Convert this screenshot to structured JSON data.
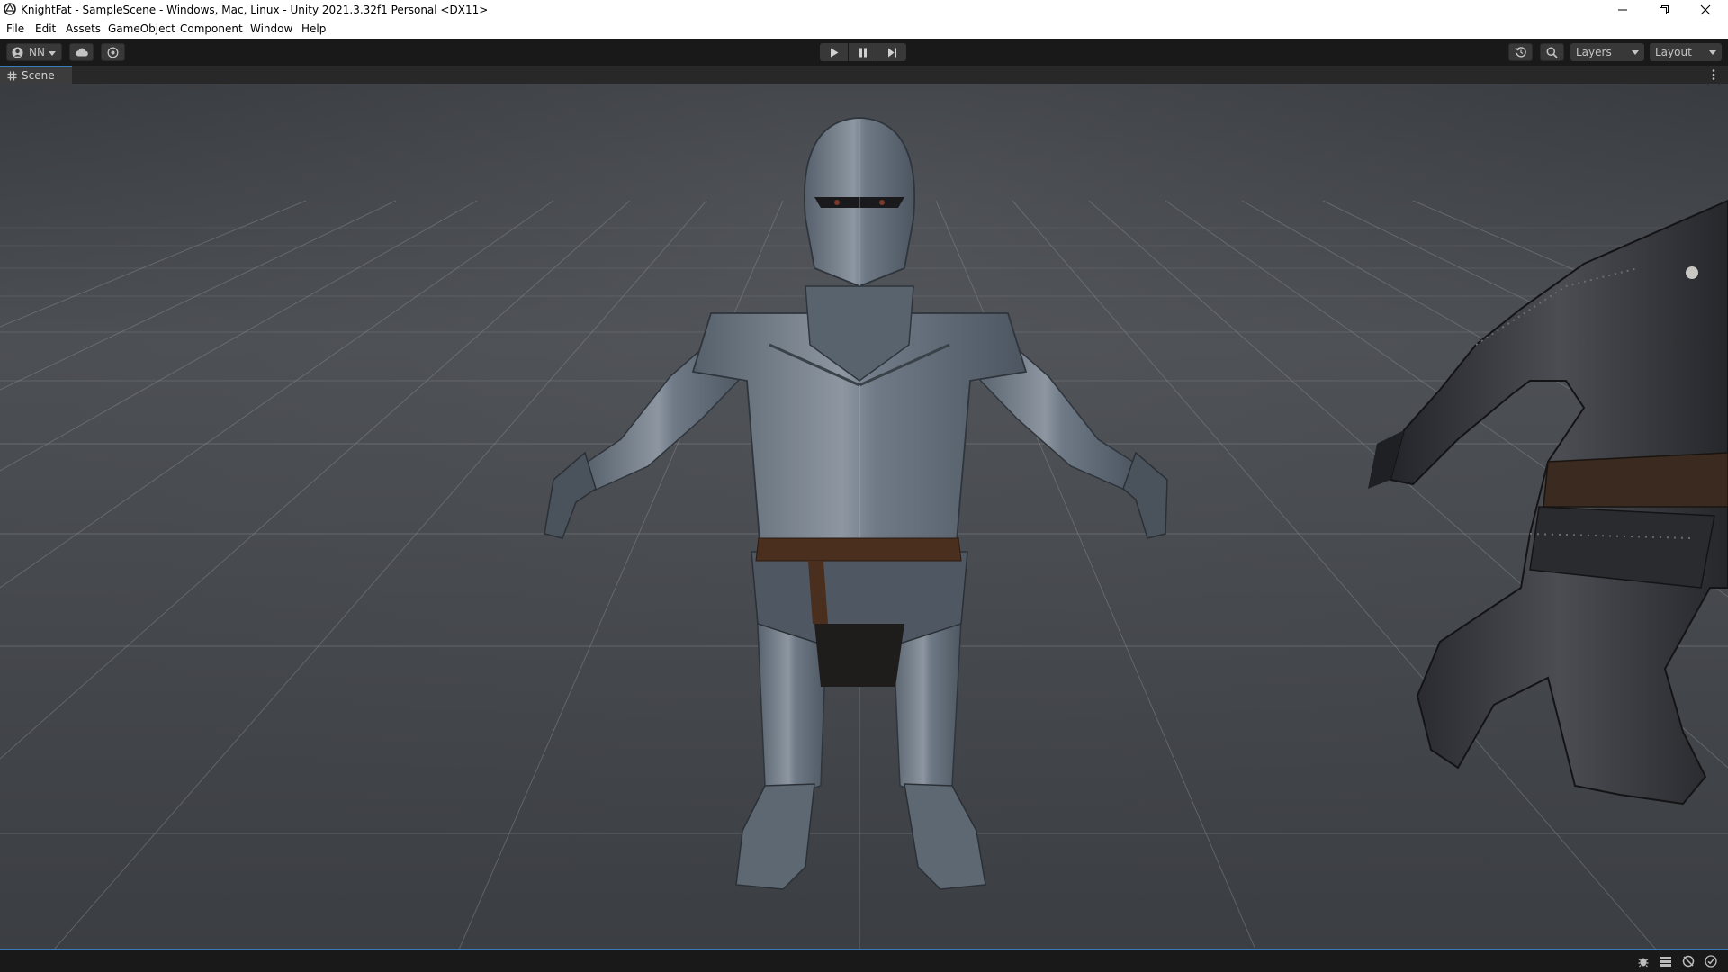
{
  "window": {
    "title": "KnightFat - SampleScene - Windows, Mac, Linux - Unity 2021.3.32f1 Personal <DX11>",
    "icon": "unity-icon",
    "controls": [
      "minimize-icon",
      "restore-icon",
      "close-icon"
    ]
  },
  "menubar": {
    "items": [
      "File",
      "Edit",
      "Assets",
      "GameObject",
      "Component",
      "Window",
      "Help"
    ]
  },
  "toolbar": {
    "account_label": "NN",
    "account_icon": "account-icon",
    "cloud_icon": "cloud-icon",
    "collab_icon": "collab-icon",
    "play_icons": [
      "play-icon",
      "pause-icon",
      "step-icon"
    ],
    "history_icon": "history-icon",
    "search_icon": "search-icon",
    "layers_label": "Layers",
    "layout_label": "Layout"
  },
  "tabs": {
    "scene_label": "Scene",
    "scene_icon": "scene-grid-icon",
    "more_icon": "kebab-menu-icon"
  },
  "status_icons": [
    "bug-icon",
    "cache-server-icon",
    "progress-icon",
    "check-icon"
  ],
  "colors": {
    "accent": "#3a79bb",
    "toolbar_bg": "#191919",
    "viewport_bg": "#404346",
    "armor_steel": "#6b7886",
    "armor_dark": "#2c2b2a",
    "leather": "#4a2e1e"
  }
}
